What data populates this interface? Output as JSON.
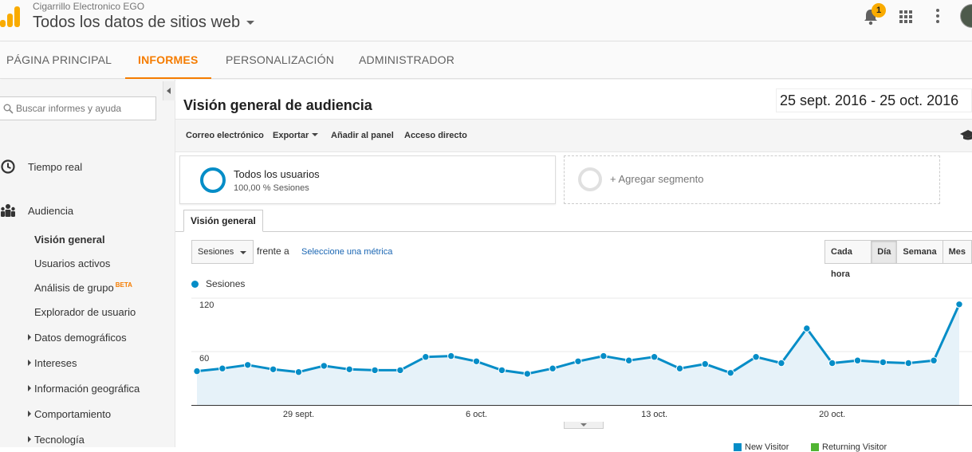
{
  "header": {
    "account_name": "Cigarrillo Electronico EGO",
    "property_name": "Todos los datos de sitios web",
    "notification_count": "1",
    "colors": {
      "brand": "#f9ab00",
      "accent": "#f57c00",
      "series": "#058dc7"
    }
  },
  "nav": {
    "tabs": [
      "PÁGINA PRINCIPAL",
      "INFORMES",
      "PERSONALIZACIÓN",
      "ADMINISTRADOR"
    ],
    "active": "INFORMES"
  },
  "sidebar": {
    "search_placeholder": "Buscar informes y ayuda",
    "sections": [
      {
        "label": "Tiempo real",
        "icon": "clock-icon"
      },
      {
        "label": "Audiencia",
        "icon": "people-icon"
      }
    ],
    "audience_items": [
      {
        "label": "Visión general",
        "active": true
      },
      {
        "label": "Usuarios activos"
      },
      {
        "label": "Análisis de grupo",
        "badge": "BETA"
      },
      {
        "label": "Explorador de usuario"
      },
      {
        "label": "Datos demográficos",
        "expandable": true
      },
      {
        "label": "Intereses",
        "expandable": true
      },
      {
        "label": "Información geográfica",
        "expandable": true
      },
      {
        "label": "Comportamiento",
        "expandable": true
      },
      {
        "label": "Tecnología",
        "expandable": true
      }
    ]
  },
  "report": {
    "title": "Visión general de audiencia",
    "date_range": "25 sept. 2016 - 25 oct. 2016",
    "toolbar": {
      "email": "Correo electrónico",
      "export": "Exportar",
      "add_dashboard": "Añadir al panel",
      "shortcut": "Acceso directo"
    },
    "segment": {
      "name": "Todos los usuarios",
      "detail": "100,00 % Sesiones"
    },
    "add_segment": "+ Agregar segmento",
    "tab": "Visión general",
    "metric_select": "Sesiones",
    "versus": "frente a",
    "select_metric": "Seleccione una métrica",
    "granularity": [
      "Cada hora",
      "Día",
      "Semana",
      "Mes"
    ],
    "granularity_active": "Día",
    "bottom_legend": [
      "New Visitor",
      "Returning Visitor"
    ]
  },
  "chart_data": {
    "type": "area",
    "series": [
      {
        "name": "Sesiones",
        "color": "#058dc7",
        "values": [
          38,
          41,
          45,
          40,
          37,
          44,
          40,
          39,
          39,
          54,
          55,
          49,
          39,
          35,
          41,
          49,
          55,
          50,
          54,
          41,
          46,
          36,
          54,
          47,
          86,
          47,
          50,
          48,
          47,
          50,
          113
        ]
      }
    ],
    "x": [
      "25 sept.",
      "26 sept.",
      "27 sept.",
      "28 sept.",
      "29 sept.",
      "30 sept.",
      "1 oct.",
      "2 oct.",
      "3 oct.",
      "4 oct.",
      "5 oct.",
      "6 oct.",
      "7 oct.",
      "8 oct.",
      "9 oct.",
      "10 oct.",
      "11 oct.",
      "12 oct.",
      "13 oct.",
      "14 oct.",
      "15 oct.",
      "16 oct.",
      "17 oct.",
      "18 oct.",
      "19 oct.",
      "20 oct.",
      "21 oct.",
      "22 oct.",
      "23 oct.",
      "24 oct.",
      "25 oct."
    ],
    "x_tick_labels": [
      "29 sept.",
      "6 oct.",
      "13 oct.",
      "20 oct."
    ],
    "y_tick_labels": [
      "120",
      "60"
    ],
    "ylim": [
      0,
      120
    ],
    "grid": true,
    "legend": "top-left"
  }
}
